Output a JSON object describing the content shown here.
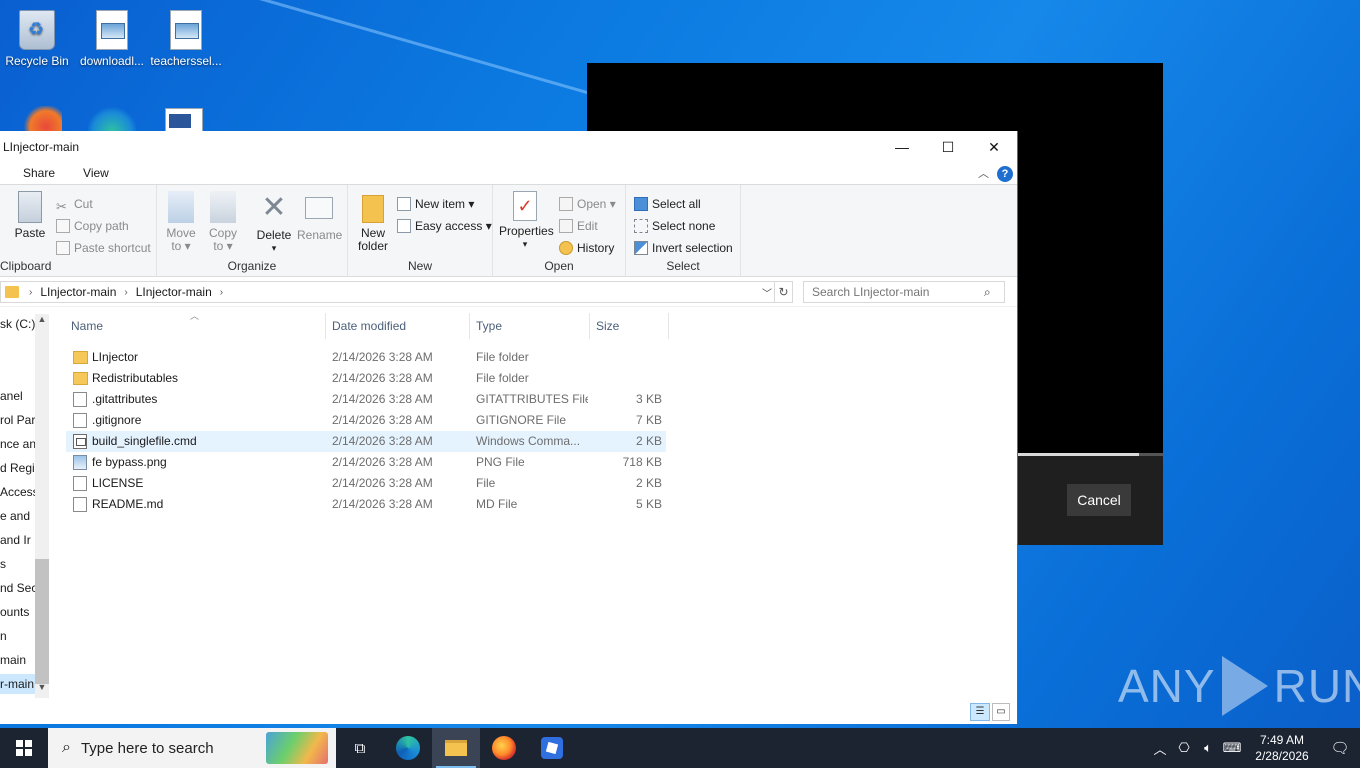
{
  "desktop": {
    "icons": [
      {
        "label": "Recycle Bin"
      },
      {
        "label": "downloadl..."
      },
      {
        "label": "teacherssel..."
      }
    ]
  },
  "dialog": {
    "cancel_label": "Cancel"
  },
  "explorer": {
    "title": "LInjector-main",
    "window_buttons": {
      "minimize": "—",
      "maximize": "☐",
      "close": "✕"
    },
    "tabs": [
      "Share",
      "View"
    ],
    "ribbon": {
      "clipboard": {
        "label": "Clipboard",
        "paste": "Paste",
        "cut": "Cut",
        "copy_path": "Copy path",
        "paste_shortcut": "Paste shortcut"
      },
      "organize": {
        "label": "Organize",
        "move_to_1": "Move",
        "move_to_2": "to ▾",
        "copy_to_1": "Copy",
        "copy_to_2": "to ▾",
        "delete_1": "Delete",
        "delete_2": "▾",
        "rename": "Rename"
      },
      "new": {
        "label": "New",
        "new_folder_1": "New",
        "new_folder_2": "folder",
        "new_item": "New item ▾",
        "easy_access": "Easy access ▾"
      },
      "open": {
        "label": "Open",
        "properties_1": "Properties",
        "properties_2": "▾",
        "open": "Open ▾",
        "edit": "Edit",
        "history": "History"
      },
      "select": {
        "label": "Select",
        "select_all": "Select all",
        "select_none": "Select none",
        "invert_selection": "Invert selection"
      }
    },
    "address": {
      "crumbs": [
        "LInjector-main",
        "LInjector-main"
      ]
    },
    "search_placeholder": "Search LInjector-main",
    "nav_items": [
      "sk (C:)",
      "anel",
      "rol Par",
      "nce an",
      "d Regi",
      "Access",
      "e and",
      " and Ir",
      "s",
      "nd Sec",
      "ounts",
      "n",
      "main",
      "r-main"
    ],
    "columns": {
      "name": "Name",
      "date": "Date modified",
      "type": "Type",
      "size": "Size"
    },
    "files": [
      {
        "name": "LInjector",
        "date": "2/14/2026 3:28 AM",
        "type": "File folder",
        "size": "",
        "icon": "folder"
      },
      {
        "name": "Redistributables",
        "date": "2/14/2026 3:28 AM",
        "type": "File folder",
        "size": "",
        "icon": "folder"
      },
      {
        "name": ".gitattributes",
        "date": "2/14/2026 3:28 AM",
        "type": "GITATTRIBUTES File",
        "size": "3 KB",
        "icon": "file"
      },
      {
        "name": ".gitignore",
        "date": "2/14/2026 3:28 AM",
        "type": "GITIGNORE File",
        "size": "7 KB",
        "icon": "file"
      },
      {
        "name": "build_singlefile.cmd",
        "date": "2/14/2026 3:28 AM",
        "type": "Windows Comma...",
        "size": "2 KB",
        "icon": "cmd"
      },
      {
        "name": "fe bypass.png",
        "date": "2/14/2026 3:28 AM",
        "type": "PNG File",
        "size": "718 KB",
        "icon": "img"
      },
      {
        "name": "LICENSE",
        "date": "2/14/2026 3:28 AM",
        "type": "File",
        "size": "2 KB",
        "icon": "file"
      },
      {
        "name": "README.md",
        "date": "2/14/2026 3:28 AM",
        "type": "MD File",
        "size": "5 KB",
        "icon": "file"
      }
    ]
  },
  "taskbar": {
    "search_text": "Type here to search",
    "time": "7:49 AM",
    "date": "2/28/2026"
  },
  "watermark": {
    "left": "ANY",
    "right": "RUN"
  }
}
